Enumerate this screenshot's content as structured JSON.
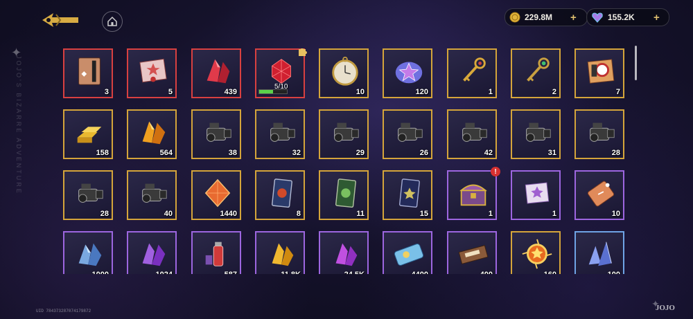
{
  "header": {
    "currencies": [
      {
        "name": "gold-coin",
        "amount": "229.8M",
        "color": "#e2b43c"
      },
      {
        "name": "gem",
        "amount": "155.2K",
        "color": "#a77be8"
      }
    ]
  },
  "side_text": "JOJO'S BIZARRE ADVENTURE",
  "uid": "UID 784373287074179872",
  "brand": "JOJO",
  "items": [
    {
      "id": "r0c0",
      "rarity": "red",
      "icon": "notebook-icon",
      "qty": "3"
    },
    {
      "id": "r0c1",
      "rarity": "red",
      "icon": "envelope-star-icon",
      "qty": "5"
    },
    {
      "id": "r0c2",
      "rarity": "red",
      "icon": "red-crystal-icon",
      "qty": "439"
    },
    {
      "id": "r0c3",
      "rarity": "red",
      "icon": "red-gem-fragment-icon",
      "qty": "",
      "progress": "5/10",
      "progress_value": 0.5
    },
    {
      "id": "r0c4",
      "rarity": "gold",
      "icon": "pocket-watch-icon",
      "qty": "10"
    },
    {
      "id": "r0c5",
      "rarity": "gold",
      "icon": "star-stone-icon",
      "qty": "120"
    },
    {
      "id": "r0c6",
      "rarity": "gold",
      "icon": "golden-key-icon",
      "qty": "1"
    },
    {
      "id": "r0c7",
      "rarity": "gold",
      "icon": "emerald-key-icon",
      "qty": "2"
    },
    {
      "id": "r0c8",
      "rarity": "gold",
      "icon": "ticket-box-icon",
      "qty": "7"
    },
    {
      "id": "r1c0",
      "rarity": "gold",
      "icon": "gold-bars-icon",
      "qty": "158"
    },
    {
      "id": "r1c1",
      "rarity": "gold",
      "icon": "orange-crystal-icon",
      "qty": "564"
    },
    {
      "id": "r1c2",
      "rarity": "gold",
      "icon": "video-camera-icon",
      "qty": "38"
    },
    {
      "id": "r1c3",
      "rarity": "gold",
      "icon": "video-camera-icon",
      "qty": "32"
    },
    {
      "id": "r1c4",
      "rarity": "gold",
      "icon": "video-camera-icon",
      "qty": "29"
    },
    {
      "id": "r1c5",
      "rarity": "gold",
      "icon": "video-camera-icon",
      "qty": "26"
    },
    {
      "id": "r1c6",
      "rarity": "gold",
      "icon": "video-camera-icon",
      "qty": "42"
    },
    {
      "id": "r1c7",
      "rarity": "gold",
      "icon": "video-camera-icon",
      "qty": "31"
    },
    {
      "id": "r1c8",
      "rarity": "gold",
      "icon": "video-camera-icon",
      "qty": "28"
    },
    {
      "id": "r2c0",
      "rarity": "gold",
      "icon": "video-camera-icon",
      "qty": "28"
    },
    {
      "id": "r2c1",
      "rarity": "gold",
      "icon": "video-camera-icon",
      "qty": "40"
    },
    {
      "id": "r2c2",
      "rarity": "gold",
      "icon": "amber-gem-icon",
      "qty": "1440"
    },
    {
      "id": "r2c3",
      "rarity": "gold",
      "icon": "blue-card-icon",
      "qty": "8"
    },
    {
      "id": "r2c4",
      "rarity": "gold",
      "icon": "green-card-icon",
      "qty": "11"
    },
    {
      "id": "r2c5",
      "rarity": "gold",
      "icon": "navy-card-icon",
      "qty": "15"
    },
    {
      "id": "r2c6",
      "rarity": "purple",
      "icon": "treasure-chest-icon",
      "qty": "1",
      "alert": "!"
    },
    {
      "id": "r2c7",
      "rarity": "purple",
      "icon": "purple-envelope-icon",
      "qty": "1"
    },
    {
      "id": "r2c8",
      "rarity": "purple",
      "icon": "tag-ticket-icon",
      "qty": "10"
    },
    {
      "id": "r3c0",
      "rarity": "purple",
      "icon": "blue-crystal-icon",
      "qty": "1000"
    },
    {
      "id": "r3c1",
      "rarity": "purple",
      "icon": "violet-crystal-icon",
      "qty": "1024"
    },
    {
      "id": "r3c2",
      "rarity": "purple",
      "icon": "spray-can-icon",
      "qty": "587"
    },
    {
      "id": "r3c3",
      "rarity": "purple",
      "icon": "yellow-crystal-icon",
      "qty": "11.8K"
    },
    {
      "id": "r3c4",
      "rarity": "purple",
      "icon": "magenta-crystal-icon",
      "qty": "24.5K"
    },
    {
      "id": "r3c5",
      "rarity": "purple",
      "icon": "ticket-icon",
      "qty": "4400"
    },
    {
      "id": "r3c6",
      "rarity": "purple",
      "icon": "coffee-bar-icon",
      "qty": "400"
    },
    {
      "id": "r3c7",
      "rarity": "gold",
      "icon": "sun-orb-icon",
      "qty": "160"
    },
    {
      "id": "r3c8",
      "rarity": "blue",
      "icon": "blue-shards-icon",
      "qty": "100"
    }
  ]
}
